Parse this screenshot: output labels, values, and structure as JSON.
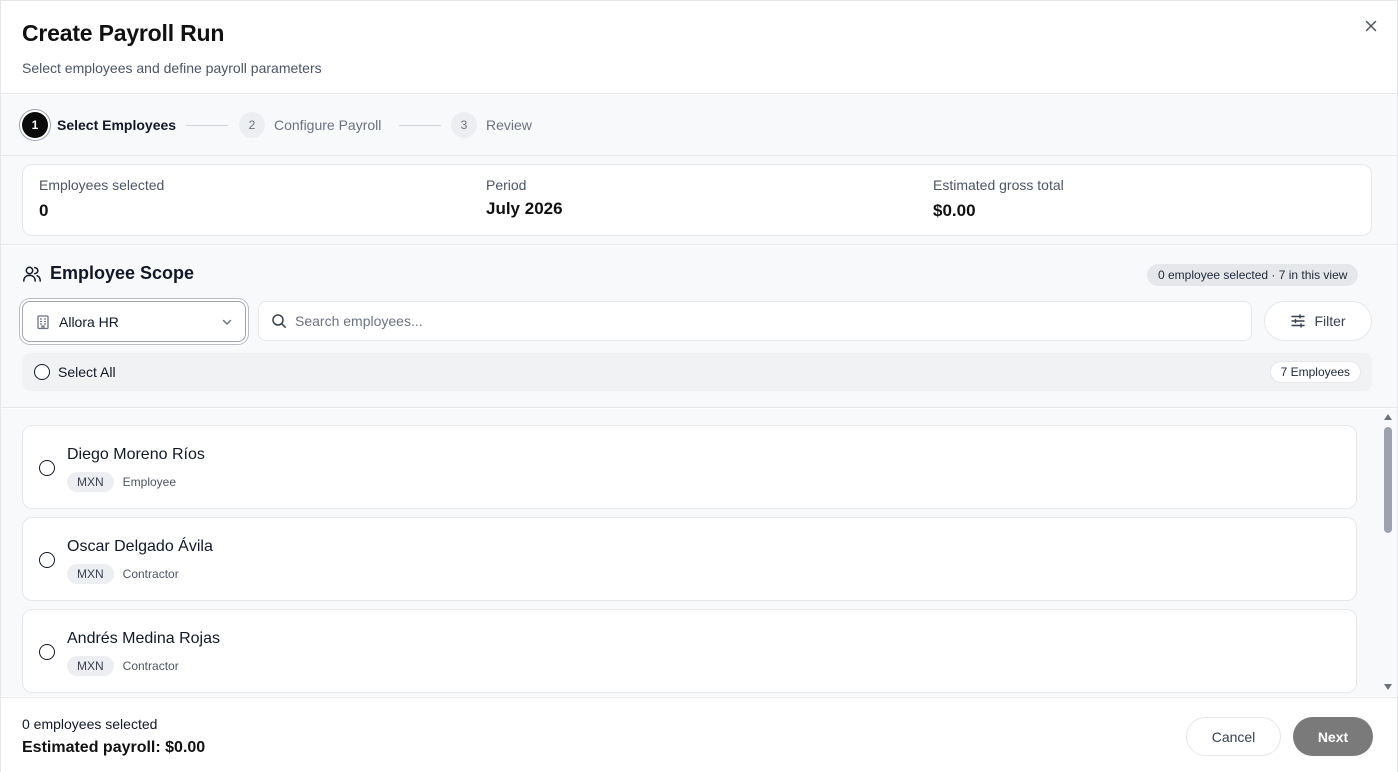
{
  "dialog": {
    "title": "Create Payroll Run",
    "subtitle": "Select employees and define payroll parameters"
  },
  "stepper": {
    "steps": [
      {
        "number": "1",
        "label": "Select Employees",
        "active": true
      },
      {
        "number": "2",
        "label": "Configure Payroll",
        "active": false
      },
      {
        "number": "3",
        "label": "Review",
        "active": false
      }
    ]
  },
  "summary": {
    "employees_selected_label": "Employees selected",
    "employees_selected_value": "0",
    "period_label": "Period",
    "period_value": "July 2026",
    "gross_total_label": "Estimated gross total",
    "gross_total_value": "$0.00"
  },
  "scope": {
    "title": "Employee Scope",
    "badge": "0 employee selected · 7 in this view",
    "company_select": "Allora HR",
    "search_placeholder": "Search employees...",
    "search_value": "",
    "filter_label": "Filter",
    "select_all_label": "Select All",
    "employee_count_badge": "7 Employees"
  },
  "employees": [
    {
      "name": "Diego Moreno Ríos",
      "currency": "MXN",
      "type": "Employee"
    },
    {
      "name": "Oscar Delgado Ávila",
      "currency": "MXN",
      "type": "Contractor"
    },
    {
      "name": "Andrés Medina Rojas",
      "currency": "MXN",
      "type": "Contractor"
    }
  ],
  "footer": {
    "selected_text": "0 employees selected",
    "estimated_payroll": "Estimated payroll: $0.00",
    "cancel_label": "Cancel",
    "next_label": "Next"
  },
  "icons": {
    "close": "close-icon",
    "users": "users-icon",
    "building": "building-icon",
    "chevron": "chevron-down-icon",
    "search": "search-icon",
    "filter": "sliders-icon"
  },
  "colors": {
    "active_step": "#0b0b0b",
    "next_button_disabled": "#7a7a7a",
    "panel_background": "#f8f9fb",
    "border": "#e5e7eb"
  }
}
